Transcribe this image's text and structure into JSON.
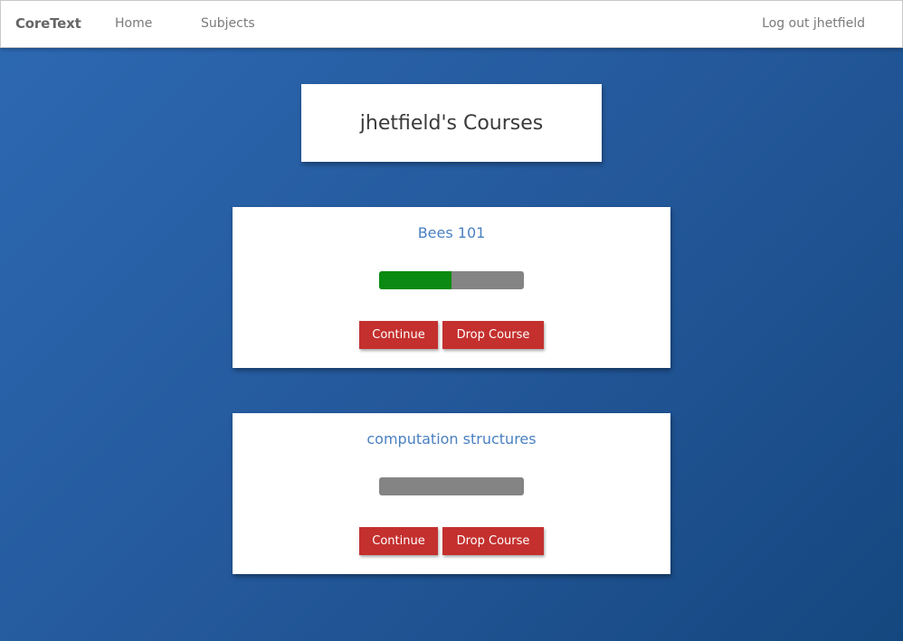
{
  "navbar": {
    "brand": "CoreText",
    "links": [
      "Home",
      "Subjects"
    ],
    "logout": "Log out jhetfield"
  },
  "page": {
    "title": "jhetfield's Courses"
  },
  "courses": [
    {
      "title": "Bees 101",
      "progress": 0.5,
      "continue_label": "Continue",
      "drop_label": "Drop Course"
    },
    {
      "title": "computation structures",
      "progress": 0,
      "continue_label": "Continue",
      "drop_label": "Drop Course"
    }
  ],
  "colors": {
    "accent": "#c4302e",
    "progress_fill": "#0a8a10",
    "progress_track": "#848484",
    "course_title": "#4a80c1"
  }
}
